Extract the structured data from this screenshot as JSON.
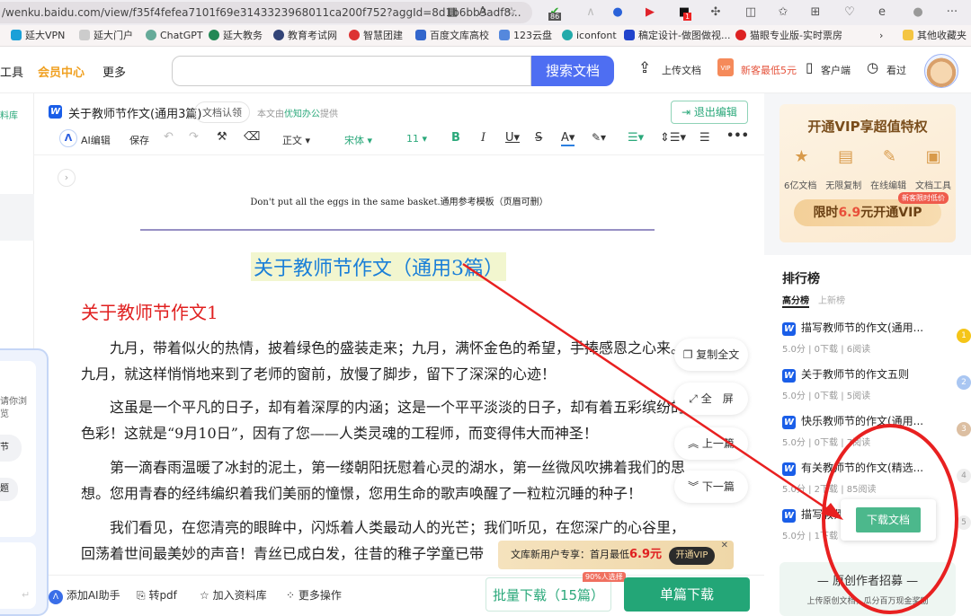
{
  "browser": {
    "url": "/wenku.baidu.com/view/f35f4fefea7101f69e3143323968011ca200f752?aggId=8d1b6bb3adf8...",
    "badge_count": "86",
    "notif_count": "1",
    "bookmarks": [
      "延大VPN",
      "延大门户",
      "ChatGPT",
      "延大教务",
      "教育考试网",
      "智慧团建",
      "百度文库高校",
      "123云盘",
      "iconfont",
      "稿定设计-做图做视...",
      "猫眼专业版-实时票房"
    ],
    "other_bookmarks": "其他收藏夹"
  },
  "header": {
    "nav": [
      "工具",
      "会员中心",
      "更多"
    ],
    "search_placeholder": "",
    "search_button": "搜索文档",
    "upload": "上传文档",
    "promo": "新客最低5元",
    "client": "客户端",
    "history": "看过"
  },
  "left": {
    "label": "料库",
    "chat_lines": [
      "请你浏",
      "览"
    ],
    "chip1": "节",
    "chip2": "题"
  },
  "doc": {
    "title": "关于教师节作文(通用3篇)",
    "claim": "文档认领",
    "provider_prefix": "本文由",
    "provider": "优知办公",
    "provider_suffix": "提供",
    "exit_edit": "退出编辑",
    "toolbar": {
      "ai": "AI编辑",
      "save": "保存",
      "style": "正文",
      "font": "宋体",
      "size": "11"
    },
    "header_line": "Don't put all the eggs in the same basket.通用参考模板（页眉可删）",
    "main_title": "关于教师节作文（通用3篇）",
    "section_title": "关于教师节作文1",
    "paragraphs": [
      "九月，带着似火的热情，披着绿色的盛装走来；九月，满怀金色的希望，手捧感恩之心来。九月，就这样悄悄地来到了老师的窗前，放慢了脚步，留下了深深的心迹！",
      "这虽是一个平凡的日子，却有着深厚的内涵；这是一个平平淡淡的日子，却有着五彩缤纷的色彩！这就是“9月10日”，因有了您——人类灵魂的工程师，而变得伟大而神圣！",
      "第一滴春雨温暖了冰封的泥土，第一缕朝阳抚慰着心灵的湖水，第一丝微风吹拂着我们的思想。您用青春的经纬编织着我们美丽的憧憬，您用生命的歌声唤醒了一粒粒沉睡的种子！",
      "我们看见，在您清亮的眼眸中，闪烁着人类最动人的光芒；我们听见，在您深广的心谷里，回荡着世间最美妙的声音！青丝已成白发，往昔的稚子学童已带"
    ],
    "float_buttons": [
      "复制全文",
      "全　屏",
      "上一篇",
      "下一篇"
    ],
    "promo": {
      "text": "文库新用户专享：首月最低",
      "price": "6.9元",
      "button": "开通VIP"
    }
  },
  "bottom": {
    "ai": "添加AI助手",
    "pdf": "转pdf",
    "library": "加入资料库",
    "more": "更多操作",
    "batch": "批量下载（15篇）",
    "batch_badge": "90%人选择",
    "single": "单篇下载"
  },
  "vip": {
    "title": "开通VIP享超值特权",
    "features": [
      "6亿文档",
      "无限复制",
      "在线编辑",
      "文档工具"
    ],
    "badge": "新客限时低价",
    "cta_prefix": "限时",
    "cta_price": "6.9",
    "cta_suffix": "元开通VIP"
  },
  "ranking": {
    "title": "排行榜",
    "tabs": [
      "高分榜",
      "上新榜"
    ],
    "items": [
      {
        "title": "描写教师节的作文(通用...",
        "score": "5.0分",
        "downloads": "0下载",
        "reads": "6阅读",
        "rank": "1"
      },
      {
        "title": "关于教师节的作文五则",
        "score": "5.0分",
        "downloads": "0下载",
        "reads": "5阅读",
        "rank": "2"
      },
      {
        "title": "快乐教师节的作文(通用...",
        "score": "5.0分",
        "downloads": "0下载",
        "reads": "7阅读",
        "rank": "3"
      },
      {
        "title": "有关教师节的作文(精选...",
        "score": "5.0分",
        "downloads": "2下载",
        "reads": "85阅读",
        "rank": "4"
      },
      {
        "title": "描写教师节...",
        "score": "5.0分",
        "downloads": "1下载",
        "reads": "",
        "rank": "5"
      }
    ]
  },
  "download_popup": "下载文档",
  "recruit": {
    "title": "原创作者招募",
    "sub": "上传原创文档，瓜分百万现金奖励"
  },
  "colors": {
    "green": "#2aa87a",
    "blue": "#4e6ef2",
    "red": "#e02020",
    "gold": "#f0a020"
  }
}
